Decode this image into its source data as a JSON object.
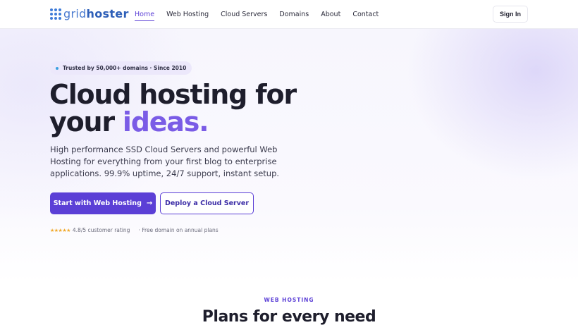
{
  "brand": {
    "name_light": "grid",
    "name_bold": "hoster",
    "icon": "grid-dots-logo-icon",
    "color": "#3d7bd8"
  },
  "nav": {
    "links": [
      "Home",
      "Web Hosting",
      "Cloud Servers",
      "Domains",
      "About",
      "Contact"
    ],
    "active": "Home",
    "signin_label": "Sign In"
  },
  "hero": {
    "badge": "Trusted by 50,000+ domains · Since 2010",
    "title_line1": "Cloud hosting for",
    "title_line2_plain": "your ",
    "title_line2_accent": "ideas.",
    "subtitle": "High performance SSD Cloud Servers and powerful Web Hosting for everything from your first blog to enterprise applications. 99.9% uptime, 24/7 support, instant setup.",
    "primary_button": "Start with Web Hosting",
    "primary_arrow": "→",
    "secondary_button": "Deploy a Cloud Server",
    "stars": "★★★★★",
    "rating_text": "4.8/5 customer rating",
    "free_domain_text": "· Free domain on annual plans"
  },
  "section": {
    "eyebrow": "WEB HOSTING",
    "title": "Plans for every need"
  },
  "colors": {
    "accent": "#5b3fd6",
    "accent_light": "#7a5ce6",
    "star": "#f0a92a"
  }
}
